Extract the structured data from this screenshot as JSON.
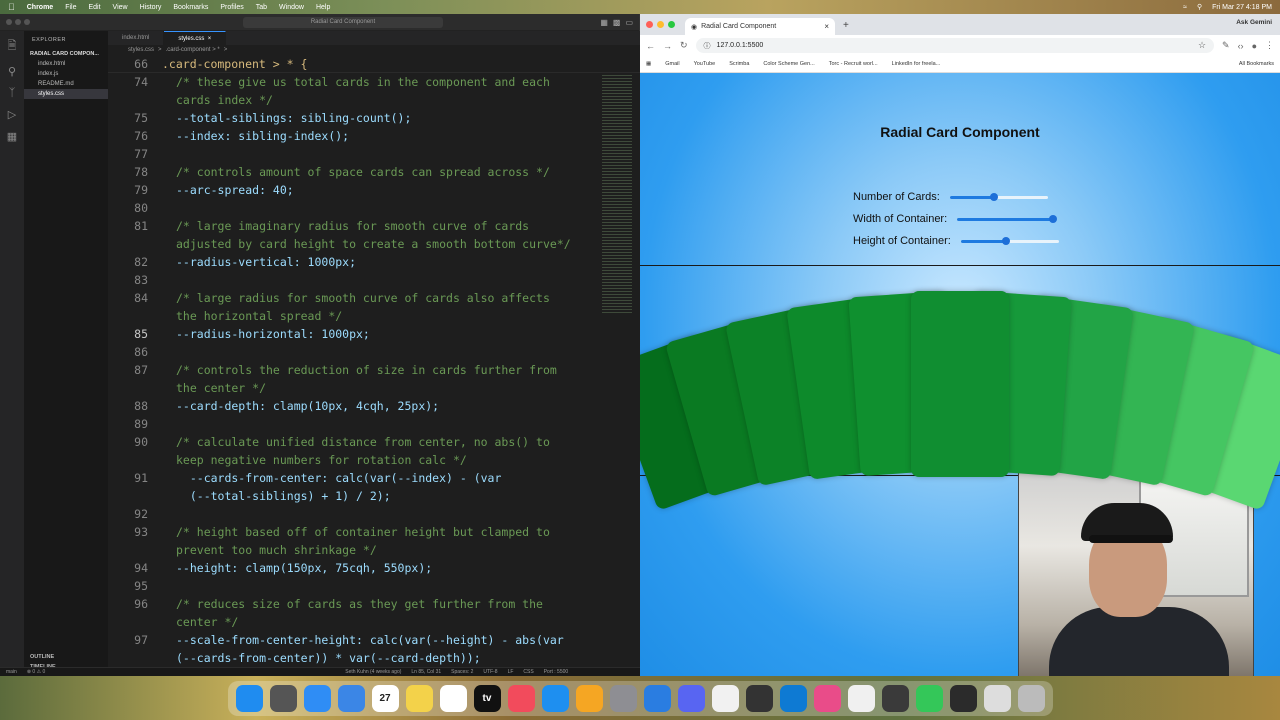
{
  "menubar": {
    "app": "Chrome",
    "items": [
      "File",
      "Edit",
      "View",
      "History",
      "Bookmarks",
      "Profiles",
      "Tab",
      "Window",
      "Help"
    ],
    "clock": "Fri Mar 27  4:18 PM"
  },
  "vscode": {
    "search": "Radial Card Component",
    "explorer_title": "EXPLORER",
    "folder": "RADIAL CARD COMPON...",
    "files": [
      "index.html",
      "index.js",
      "README.md",
      "styles.css"
    ],
    "active_file": "styles.css",
    "outline": "OUTLINE",
    "timeline": "TIMELINE",
    "tabs": [
      "index.html",
      "styles.css"
    ],
    "breadcrumb": [
      "styles.css",
      ">",
      ".card-component > *",
      ">"
    ],
    "sticky": {
      "line": "66",
      "code": ".card-component > * {"
    },
    "status": {
      "branch": "main",
      "problems": "⊗ 0 ⚠ 0",
      "blame": "Seth Kuhn (4 weeks ago)",
      "position": "Ln 85, Col 31",
      "spaces": "Spaces: 2",
      "encoding": "UTF-8",
      "eol": "LF",
      "lang": "CSS",
      "port": "Port : 5500"
    },
    "lines": [
      {
        "n": "74",
        "t": "/* these give us total cards in the component and each",
        "k": "cm"
      },
      {
        "n": "",
        "t": "cards index */",
        "k": "cm"
      },
      {
        "n": "75",
        "t": "--total-siblings: sibling-count();",
        "k": "code"
      },
      {
        "n": "76",
        "t": "--index: sibling-index();",
        "k": "code"
      },
      {
        "n": "77",
        "t": "",
        "k": "pl"
      },
      {
        "n": "78",
        "t": "/* controls amount of space cards can spread across */",
        "k": "cm"
      },
      {
        "n": "79",
        "t": "--arc-spread: 40;",
        "k": "code"
      },
      {
        "n": "80",
        "t": "",
        "k": "pl"
      },
      {
        "n": "81",
        "t": "/* large imaginary radius for smooth curve of cards",
        "k": "cm"
      },
      {
        "n": "",
        "t": "adjusted by card height to create a smooth bottom curve*/",
        "k": "cm"
      },
      {
        "n": "82",
        "t": "--radius-vertical: 1000px;",
        "k": "code"
      },
      {
        "n": "83",
        "t": "",
        "k": "pl"
      },
      {
        "n": "84",
        "t": "/* large radius for smooth curve of cards also affects",
        "k": "cm"
      },
      {
        "n": "",
        "t": "the horizontal spread */",
        "k": "cm"
      },
      {
        "n": "85",
        "t": "--radius-horizontal: 1000px;",
        "k": "code",
        "cur": true
      },
      {
        "n": "86",
        "t": "",
        "k": "pl"
      },
      {
        "n": "87",
        "t": "/* controls the reduction of size in cards further from",
        "k": "cm"
      },
      {
        "n": "",
        "t": "the center */",
        "k": "cm"
      },
      {
        "n": "88",
        "t": "--card-depth: clamp(10px, 4cqh, 25px);",
        "k": "code"
      },
      {
        "n": "89",
        "t": "",
        "k": "pl"
      },
      {
        "n": "90",
        "t": "/* calculate unified distance from center, no abs() to",
        "k": "cm"
      },
      {
        "n": "",
        "t": "keep negative numbers for rotation calc */",
        "k": "cm"
      },
      {
        "n": "91",
        "t": "  --cards-from-center: calc(var(--index) - (var",
        "k": "code"
      },
      {
        "n": "",
        "t": "  (--total-siblings) + 1) / 2);",
        "k": "code"
      },
      {
        "n": "92",
        "t": "",
        "k": "pl"
      },
      {
        "n": "93",
        "t": "/* height based off of container height but clamped to",
        "k": "cm"
      },
      {
        "n": "",
        "t": "prevent too much shrinkage */",
        "k": "cm"
      },
      {
        "n": "94",
        "t": "--height: clamp(150px, 75cqh, 550px);",
        "k": "code"
      },
      {
        "n": "95",
        "t": "",
        "k": "pl"
      },
      {
        "n": "96",
        "t": "/* reduces size of cards as they get further from the",
        "k": "cm"
      },
      {
        "n": "",
        "t": "center */",
        "k": "cm"
      },
      {
        "n": "97",
        "t": "--scale-from-center-height: calc(var(--height) - abs(var",
        "k": "code"
      },
      {
        "n": "",
        "t": "(--cards-from-center)) * var(--card-depth));",
        "k": "code"
      }
    ]
  },
  "chrome": {
    "tab_title": "Radial Card Component",
    "ask": "Ask Gemini",
    "url": "127.0.0.1:5500",
    "bookmarks": [
      "Gmail",
      "YouTube",
      "Scrimba",
      "Color Scheme Gen...",
      "Torc - Recruit worl...",
      "LinkedIn for freela..."
    ],
    "all_bookmarks": "All Bookmarks",
    "page": {
      "title": "Radial Card Component",
      "controls": [
        {
          "label": "Number of Cards:",
          "value": 0.45
        },
        {
          "label": "Width of Container:",
          "value": 0.98
        },
        {
          "label": "Height of Container:",
          "value": 0.46
        }
      ],
      "card_count": 11,
      "card_colors": [
        "#056d1c",
        "#0a7a22",
        "#0c8227",
        "#0d8a2b",
        "#0f902f",
        "#108e31",
        "#16993a",
        "#22a446",
        "#33b553",
        "#45c662",
        "#5ad772"
      ]
    }
  },
  "dock": {
    "apps": [
      "Finder",
      "Launchpad",
      "Safari",
      "Mail",
      "Calendar",
      "Notes",
      "Freeform",
      "TV",
      "Music",
      "App Store",
      "Pages",
      "Settings",
      "Preview",
      "Discord",
      "Chrome",
      "OBS",
      "VS Code",
      "Affinity",
      "Photos",
      "Lamp",
      "Messages",
      "Terminal",
      "Files",
      "Trash"
    ],
    "calendar_day": "27",
    "tv": "tv"
  }
}
